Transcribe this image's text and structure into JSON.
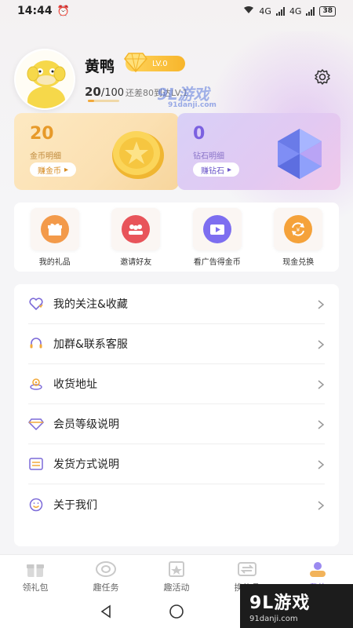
{
  "status_bar": {
    "time": "14:44",
    "battery": "38",
    "network": "4G"
  },
  "profile": {
    "name": "黄鸭",
    "level": "LV.0",
    "exp_current": "20",
    "exp_total": "/100",
    "exp_tip": "还差80到达LV.1",
    "exp_progress_fraction": 0.2
  },
  "cards": {
    "coin": {
      "value": "20",
      "label": "金币明细",
      "button": "赚金币"
    },
    "gem": {
      "value": "0",
      "label": "钻石明细",
      "button": "赚钻石"
    }
  },
  "quick_actions": [
    {
      "label": "我的礼品",
      "color": "#f39a4a",
      "icon": "gift-box-icon"
    },
    {
      "label": "邀请好友",
      "color": "#e8545a",
      "icon": "friends-icon"
    },
    {
      "label": "看广告得金币",
      "color": "#7d6ef0",
      "icon": "video-icon"
    },
    {
      "label": "现金兑换",
      "color": "#f5a23a",
      "icon": "exchange-icon"
    }
  ],
  "menu": [
    {
      "label": "我的关注&收藏",
      "icon": "heart-icon"
    },
    {
      "label": "加群&联系客服",
      "icon": "headset-icon"
    },
    {
      "label": "收货地址",
      "icon": "location-icon"
    },
    {
      "label": "会员等级说明",
      "icon": "diamond-icon"
    },
    {
      "label": "发货方式说明",
      "icon": "shipping-icon"
    },
    {
      "label": "关于我们",
      "icon": "smile-icon"
    }
  ],
  "bottom_nav": [
    {
      "label": "领礼包",
      "icon": "gift-icon"
    },
    {
      "label": "趣任务",
      "icon": "task-icon"
    },
    {
      "label": "趣活动",
      "icon": "activity-icon"
    },
    {
      "label": "换礼品",
      "icon": "swap-icon"
    },
    {
      "label": "我的",
      "icon": "profile-icon"
    }
  ],
  "watermark": {
    "main": "9L游戏",
    "sub": "91danji.com",
    "mid": "9L游戏",
    "mid_sub": "91danji.com"
  },
  "colors": {
    "accent_orange": "#f2a93b",
    "accent_purple": "#7b61e0"
  }
}
